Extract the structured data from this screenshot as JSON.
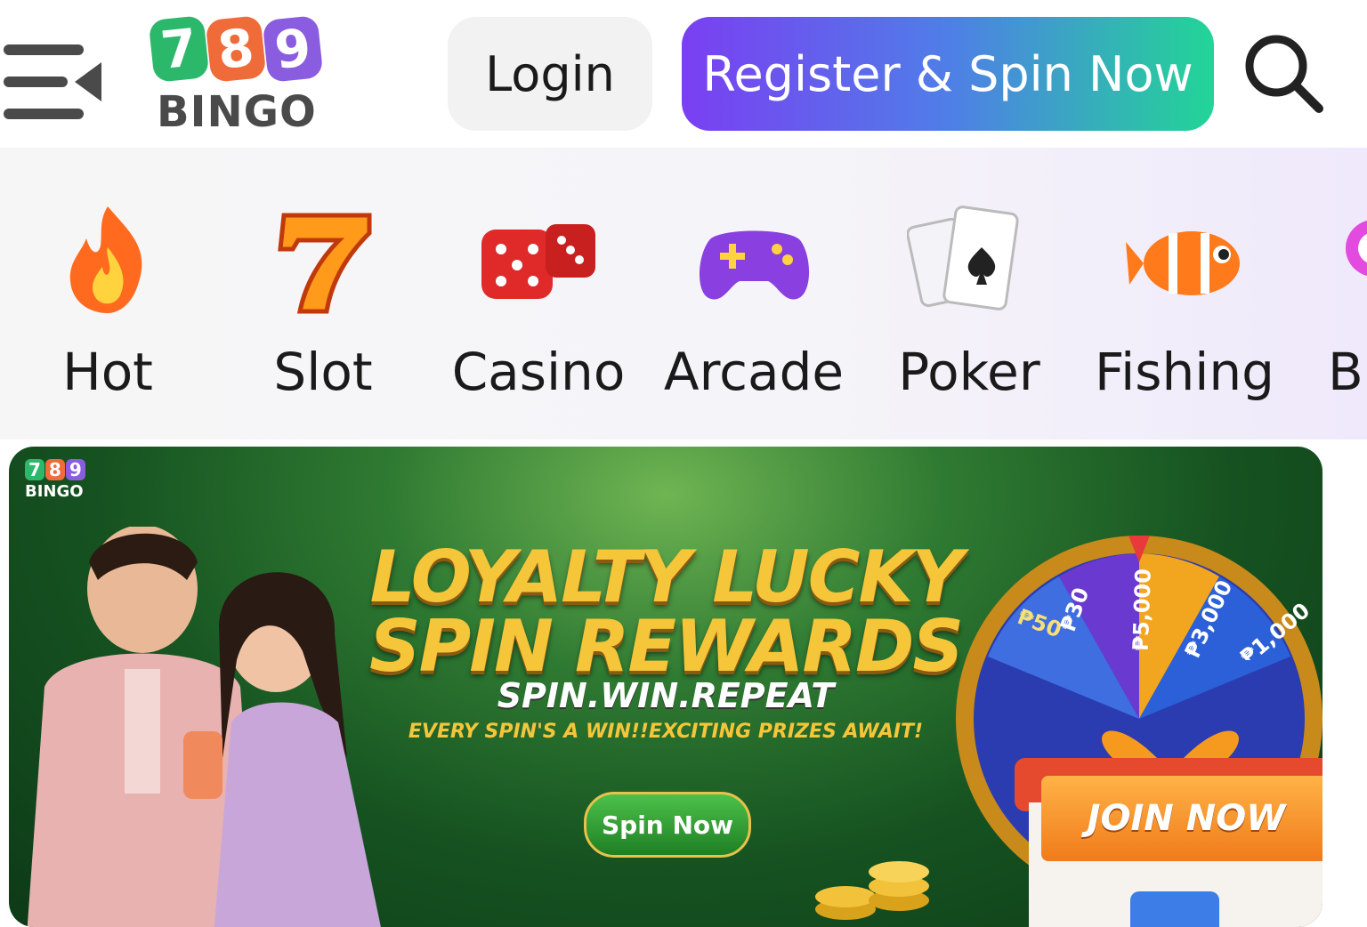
{
  "header": {
    "logo_digits": [
      "7",
      "8",
      "9"
    ],
    "logo_word": "BINGO",
    "login_label": "Login",
    "register_label": "Register & Spin Now",
    "colors": {
      "register_gradient_start": "#7a3ff2",
      "register_gradient_end": "#22d596"
    }
  },
  "categories": [
    {
      "label": "Hot",
      "icon": "fire-icon"
    },
    {
      "label": "Slot",
      "icon": "lucky-seven-icon"
    },
    {
      "label": "Casino",
      "icon": "dice-icon"
    },
    {
      "label": "Arcade",
      "icon": "gamepad-icon"
    },
    {
      "label": "Poker",
      "icon": "playing-cards-icon"
    },
    {
      "label": "Fishing",
      "icon": "clownfish-icon"
    },
    {
      "label": "Bi",
      "icon": "bingo-ball-icon"
    }
  ],
  "banner": {
    "mini_logo_digits": [
      "7",
      "8",
      "9"
    ],
    "mini_logo_word": "BINGO",
    "title_line1": "LOYALTY LUCKY",
    "title_line2": "SPIN REWARDS",
    "tagline": "SPIN.WIN.REPEAT",
    "subtagline": "EVERY SPIN'S A WIN!!EXCITING PRIZES AWAIT!",
    "spin_button": "Spin Now",
    "join_button": "JOIN NOW",
    "wheel_prizes": [
      "₱50",
      "₱30",
      "₱5,000",
      "₱3,000",
      "₱1,000"
    ]
  }
}
